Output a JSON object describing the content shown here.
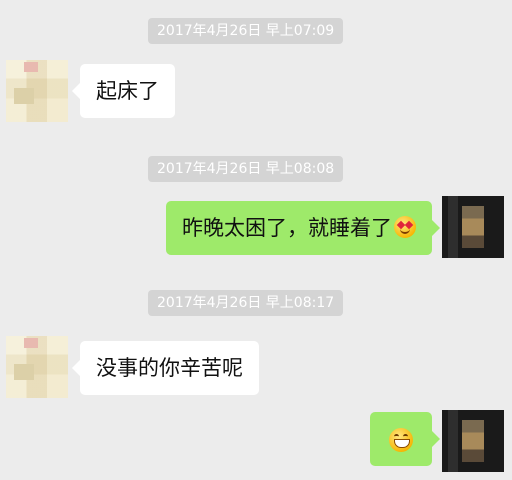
{
  "conversation": {
    "timestamps": [
      "2017年4月26日 早上07:09",
      "2017年4月26日 早上08:08",
      "2017年4月26日 早上08:17"
    ],
    "messages": [
      {
        "side": "incoming",
        "text": "起床了"
      },
      {
        "side": "outgoing",
        "text": "昨晚太困了，就睡着了",
        "emoji": "heart-eyes-emoji"
      },
      {
        "side": "incoming",
        "text": "没事的你辛苦呢"
      },
      {
        "side": "outgoing",
        "text": "",
        "emoji": "grinning-emoji"
      }
    ]
  },
  "colors": {
    "background": "#ececec",
    "timestamp_bg": "#d4d4d4",
    "incoming_bubble": "#ffffff",
    "outgoing_bubble": "#9eea6a"
  }
}
